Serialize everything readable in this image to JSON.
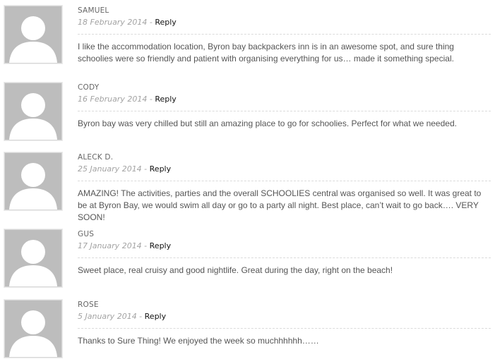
{
  "comments": [
    {
      "author": "SAMUEL",
      "date": "18 February 2014",
      "separator": " - ",
      "reply_label": "Reply",
      "text": "I like the accommodation location, Byron bay backpackers inn is in an awesome spot, and sure thing schoolies were so friendly and patient with organising everything for us… made it something special."
    },
    {
      "author": "CODY",
      "date": "16 February 2014",
      "separator": " - ",
      "reply_label": "Reply",
      "text": "Byron bay was very chilled but still an amazing place to go for schoolies. Perfect for what we needed."
    },
    {
      "author": "ALECK D.",
      "date": "25 January 2014",
      "separator": " - ",
      "reply_label": "Reply",
      "text": "AMAZING! The activities, parties and the overall SCHOOLIES central was organised so well. It was great to be at Byron Bay, we would swim all day or go to a party all night. Best place, can’t wait to go back…. VERY SOON!"
    },
    {
      "author": "GUS",
      "date": "17 January 2014",
      "separator": " - ",
      "reply_label": "Reply",
      "text": "Sweet place, real cruisy and good nightlife. Great during the day, right on the beach!"
    },
    {
      "author": "ROSE",
      "date": "5 January 2014",
      "separator": " - ",
      "reply_label": "Reply",
      "text": "Thanks to Sure Thing! We enjoyed the week so muchhhhhh……"
    }
  ]
}
